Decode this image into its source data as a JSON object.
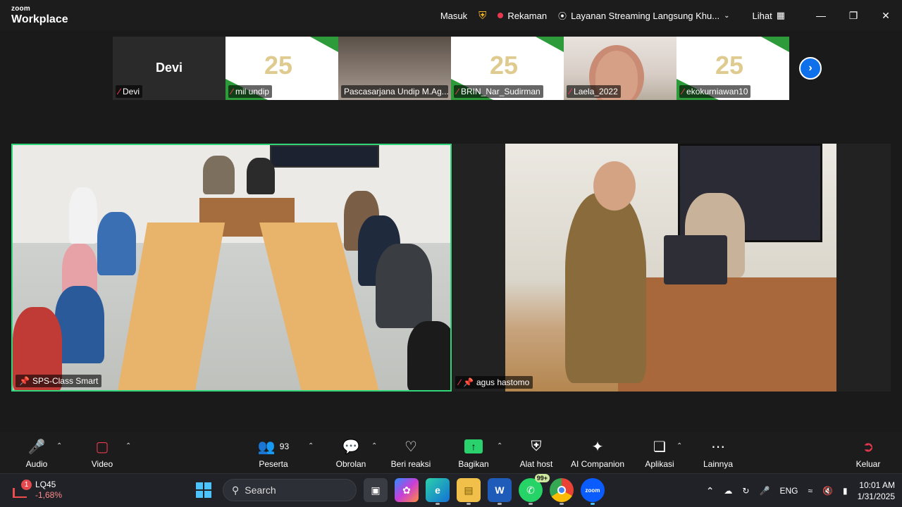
{
  "app": {
    "brand_top": "zoom",
    "brand_bottom": "Workplace"
  },
  "titlebar": {
    "signin": "Masuk",
    "recording": "Rekaman",
    "live_stream": "Layanan Streaming Langsung Khu...",
    "view": "Lihat"
  },
  "strip": {
    "tiles": [
      {
        "name": "Devi",
        "big_name": "Devi"
      },
      {
        "name": "mil undip"
      },
      {
        "name": "Pascasarjana Undip M.Ag..."
      },
      {
        "name": "BRIN_Nar_Sudirman"
      },
      {
        "name": "Laela_2022"
      },
      {
        "name": "ekokurniawan10"
      }
    ],
    "slide_logo": "25"
  },
  "main": {
    "left_name": "SPS-Class Smart",
    "right_name": "agus hastomo"
  },
  "toolbar": {
    "audio": "Audio",
    "video": "Video",
    "participants": "Peserta",
    "participants_count": "93",
    "chat": "Obrolan",
    "react": "Beri reaksi",
    "share": "Bagikan",
    "host_tools": "Alat host",
    "ai": "AI Companion",
    "apps": "Aplikasi",
    "more": "Lainnya",
    "leave": "Keluar"
  },
  "taskbar": {
    "stock_name": "LQ45",
    "stock_change": "-1,68%",
    "stock_badge": "1",
    "search_placeholder": "Search",
    "whatsapp_badge": "99+",
    "lang": "ENG",
    "time": "10:01 AM",
    "date": "1/31/2025"
  }
}
